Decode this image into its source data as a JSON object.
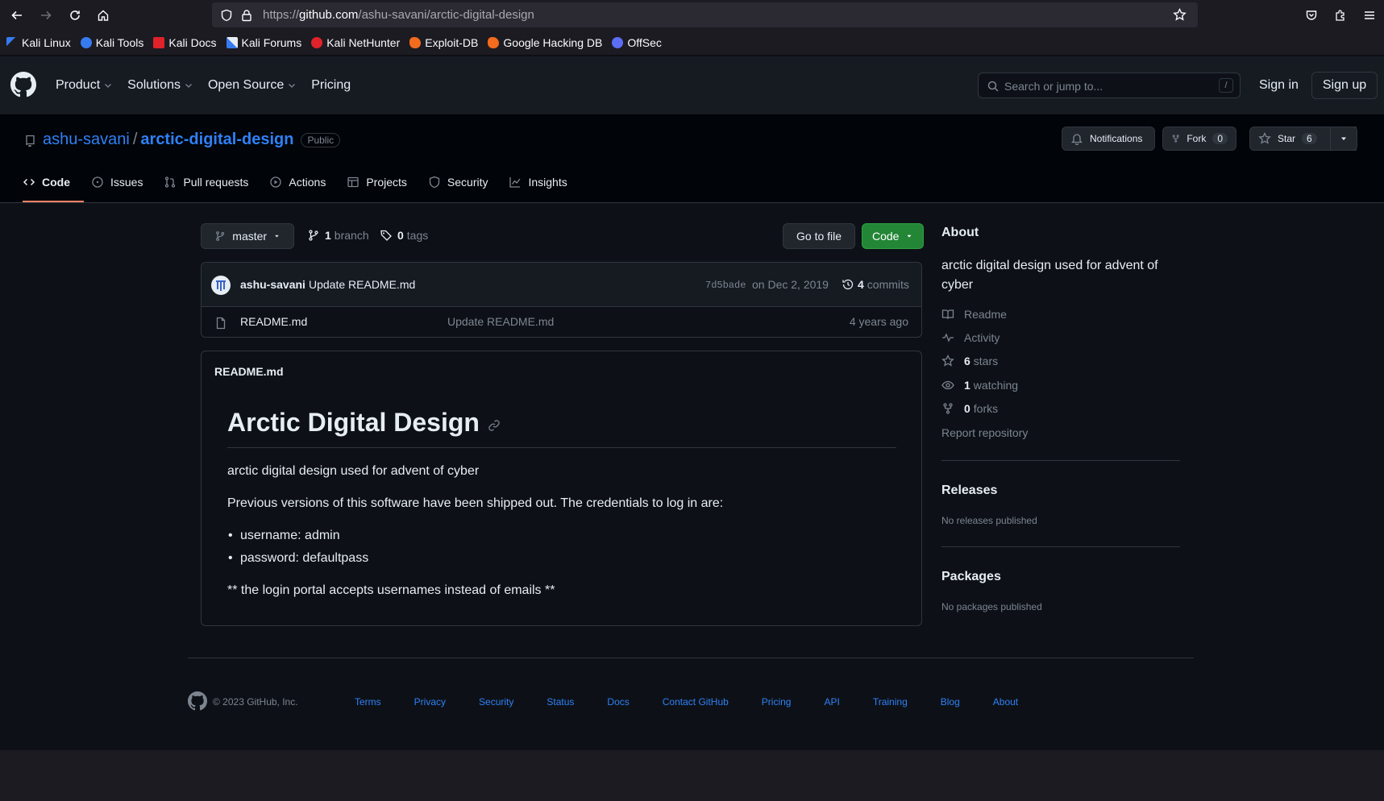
{
  "browser": {
    "url_prefix": "https://",
    "url_host": "github.com",
    "url_path": "/ashu-savani/arctic-digital-design"
  },
  "bookmarks": [
    {
      "label": "Kali Linux",
      "icon": "kali-dragon-icon",
      "color": "#367bf0"
    },
    {
      "label": "Kali Tools",
      "icon": "kali-tools-icon",
      "color": "#367bf0"
    },
    {
      "label": "Kali Docs",
      "icon": "kali-docs-icon",
      "color": "#e0222a"
    },
    {
      "label": "Kali Forums",
      "icon": "kali-forums-icon",
      "color": "#367bf0"
    },
    {
      "label": "Kali NetHunter",
      "icon": "nethunter-icon",
      "color": "#e0222a"
    },
    {
      "label": "Exploit-DB",
      "icon": "exploit-db-icon",
      "color": "#f36b1c"
    },
    {
      "label": "Google Hacking DB",
      "icon": "ghdb-icon",
      "color": "#f36b1c"
    },
    {
      "label": "OffSec",
      "icon": "offsec-icon",
      "color": "#5c6ef4"
    }
  ],
  "header": {
    "nav": [
      "Product",
      "Solutions",
      "Open Source",
      "Pricing"
    ],
    "search_placeholder": "Search or jump to...",
    "search_key": "/",
    "sign_in": "Sign in",
    "sign_up": "Sign up"
  },
  "repo": {
    "owner": "ashu-savani",
    "separator": "/",
    "name": "arctic-digital-design",
    "visibility": "Public",
    "notifications_label": "Notifications",
    "fork_label": "Fork",
    "fork_count": "0",
    "star_label": "Star",
    "star_count": "6",
    "tabs": [
      "Code",
      "Issues",
      "Pull requests",
      "Actions",
      "Projects",
      "Security",
      "Insights"
    ]
  },
  "main": {
    "branch": "master",
    "branch_count": "1",
    "branch_label": "branch",
    "tag_count": "0",
    "tag_label": "tags",
    "go_to_file": "Go to file",
    "code_button": "Code",
    "commit": {
      "author": "ashu-savani",
      "message": "Update README.md",
      "sha": "7d5bade",
      "date": "on Dec 2, 2019",
      "count": "4",
      "count_label": "commits"
    },
    "files": [
      {
        "name": "README.md",
        "message": "Update README.md",
        "age": "4 years ago"
      }
    ]
  },
  "readme": {
    "filename": "README.md",
    "title": "Arctic Digital Design",
    "p1": "arctic digital design used for advent of cyber",
    "p2": "Previous versions of this software have been shipped out. The credentials to log in are:",
    "items": [
      "username: admin",
      "password: defaultpass"
    ],
    "p3": "** the login portal accepts usernames instead of emails **"
  },
  "sidebar": {
    "about_title": "About",
    "description": "arctic digital design used for advent of cyber",
    "readme": "Readme",
    "activity": "Activity",
    "stars_count": "6",
    "stars_label": "stars",
    "watching_count": "1",
    "watching_label": "watching",
    "forks_count": "0",
    "forks_label": "forks",
    "report": "Report repository",
    "releases_title": "Releases",
    "releases_empty": "No releases published",
    "packages_title": "Packages",
    "packages_empty": "No packages published"
  },
  "footer": {
    "copyright": "© 2023 GitHub, Inc.",
    "links": [
      "Terms",
      "Privacy",
      "Security",
      "Status",
      "Docs",
      "Contact GitHub",
      "Pricing",
      "API",
      "Training",
      "Blog",
      "About"
    ]
  },
  "colors": {
    "accent": "#2f81f7",
    "code_button": "#238636",
    "tab_underline": "#f78166"
  }
}
